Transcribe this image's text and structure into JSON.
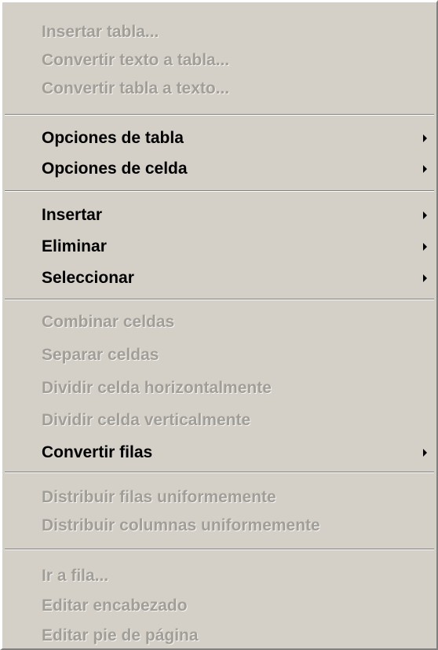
{
  "menu": {
    "items": [
      {
        "label": "Insertar tabla...",
        "enabled": false,
        "submenu": false
      },
      {
        "label": "Convertir texto a tabla...",
        "enabled": false,
        "submenu": false
      },
      {
        "label": "Convertir tabla a texto...",
        "enabled": false,
        "submenu": false
      },
      {
        "label": "Opciones de tabla",
        "enabled": true,
        "submenu": true
      },
      {
        "label": "Opciones de celda",
        "enabled": true,
        "submenu": true
      },
      {
        "label": "Insertar",
        "enabled": true,
        "submenu": true
      },
      {
        "label": "Eliminar",
        "enabled": true,
        "submenu": true
      },
      {
        "label": "Seleccionar",
        "enabled": true,
        "submenu": true
      },
      {
        "label": "Combinar celdas",
        "enabled": false,
        "submenu": false
      },
      {
        "label": "Separar celdas",
        "enabled": false,
        "submenu": false
      },
      {
        "label": "Dividir celda horizontalmente",
        "enabled": false,
        "submenu": false
      },
      {
        "label": "Dividir celda verticalmente",
        "enabled": false,
        "submenu": false
      },
      {
        "label": "Convertir filas",
        "enabled": true,
        "submenu": true
      },
      {
        "label": "Distribuir filas uniformemente",
        "enabled": false,
        "submenu": false
      },
      {
        "label": "Distribuir columnas uniformemente",
        "enabled": false,
        "submenu": false
      },
      {
        "label": "Ir a fila...",
        "enabled": false,
        "submenu": false
      },
      {
        "label": "Editar encabezado",
        "enabled": false,
        "submenu": false
      },
      {
        "label": "Editar pie de página",
        "enabled": false,
        "submenu": false
      }
    ]
  }
}
